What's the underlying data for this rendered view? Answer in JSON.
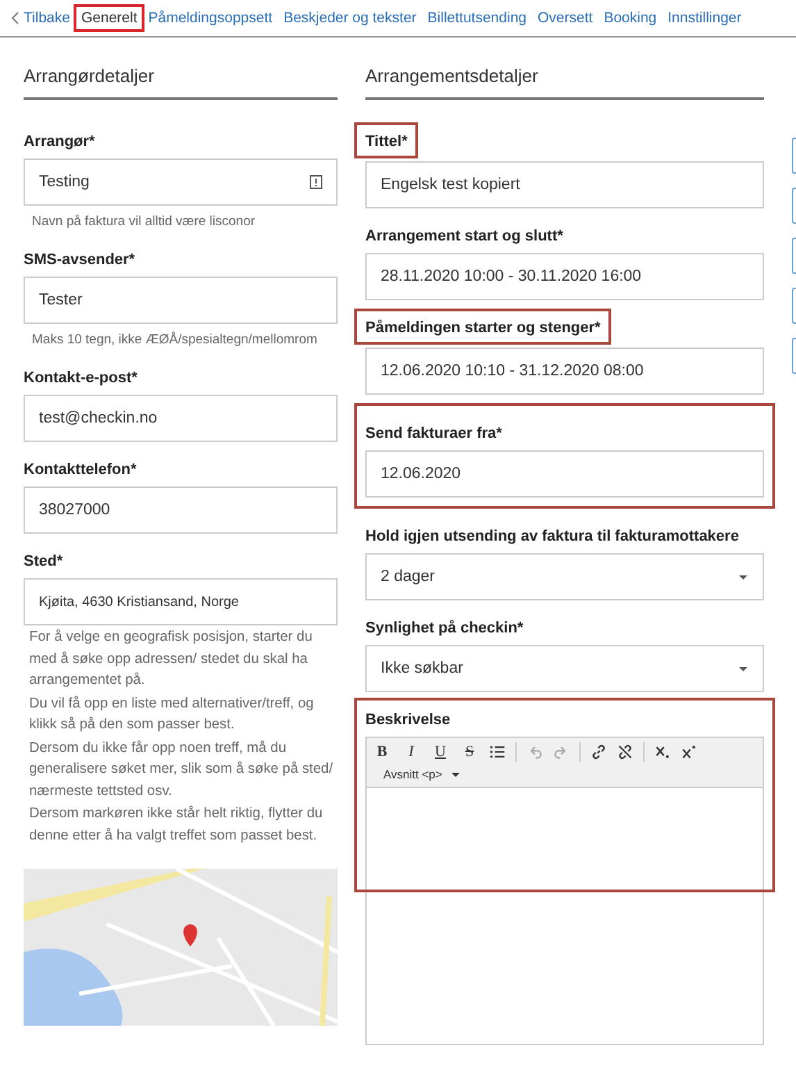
{
  "nav": {
    "back": "Tilbake",
    "tabs": [
      {
        "label": "Generelt",
        "selected": true,
        "highlighted": true
      },
      {
        "label": "Påmeldingsoppsett",
        "selected": false,
        "highlighted": false
      },
      {
        "label": "Beskjeder og tekster",
        "selected": false,
        "highlighted": false
      },
      {
        "label": "Billettutsending",
        "selected": false,
        "highlighted": false
      },
      {
        "label": "Oversett",
        "selected": false,
        "highlighted": false
      },
      {
        "label": "Booking",
        "selected": false,
        "highlighted": false
      },
      {
        "label": "Innstillinger",
        "selected": false,
        "highlighted": false
      }
    ]
  },
  "organizer": {
    "title": "Arrangørdetaljer",
    "fields": [
      {
        "kind": "text",
        "label": "Arrangør*",
        "value": "Testing",
        "info_icon": true,
        "hint": "Navn på faktura vil alltid være lisconor"
      },
      {
        "kind": "text",
        "label": "SMS-avsender*",
        "value": "Tester",
        "hint": "Maks 10 tegn, ikke ÆØÅ/spesialtegn/mellomrom"
      },
      {
        "kind": "text",
        "label": "Kontakt-e-post*",
        "value": "test@checkin.no"
      },
      {
        "kind": "text",
        "label": "Kontakttelefon*",
        "value": "38027000"
      },
      {
        "kind": "place",
        "label": "Sted*",
        "value": "Kjøita, 4630 Kristiansand, Norge",
        "help": [
          "For å velge en geografisk posisjon, starter du med å søke opp adressen/ stedet du skal ha arrangementet på.",
          "Du vil få opp en liste med alternativer/treff, og klikk så på den som passer best.",
          "Dersom du ikke får opp noen treff, må du generalisere søket mer, slik som å søke på sted/ nærmeste tettsted osv.",
          "Dersom markøren ikke står helt riktig, flytter du denne etter å ha valgt treffet som passet best."
        ]
      }
    ]
  },
  "event": {
    "title": "Arrangementsdetaljer",
    "fields": [
      {
        "kind": "text",
        "label": "Tittel*",
        "value": "Engelsk test kopiert",
        "label_highlighted": true
      },
      {
        "kind": "text",
        "label": "Arrangement start og slutt*",
        "value": "28.11.2020 10:00 - 30.11.2020 16:00"
      },
      {
        "kind": "text",
        "label": "Påmeldingen starter og stenger*",
        "value": "12.06.2020 10:10 - 31.12.2020 08:00",
        "label_highlighted": true
      },
      {
        "kind": "text",
        "label": "Send fakturaer fra*",
        "value": "12.06.2020",
        "group_highlighted": true
      },
      {
        "kind": "select",
        "label": "Hold igjen utsending av faktura til fakturamottakere",
        "value": "2 dager"
      },
      {
        "kind": "select",
        "label": "Synlighet på checkin*",
        "value": "Ikke søkbar"
      },
      {
        "kind": "editor",
        "label": "Beskrivelse",
        "group_highlighted": true,
        "toolbar": [
          {
            "kind": "bold",
            "label": "B"
          },
          {
            "kind": "italic",
            "label": "I"
          },
          {
            "kind": "underline",
            "label": "U"
          },
          {
            "kind": "strike",
            "label": "S"
          },
          {
            "kind": "list"
          },
          {
            "kind": "sep"
          },
          {
            "kind": "undo"
          },
          {
            "kind": "redo"
          },
          {
            "kind": "sep"
          },
          {
            "kind": "link"
          },
          {
            "kind": "unlink"
          },
          {
            "kind": "sep"
          },
          {
            "kind": "subscript"
          },
          {
            "kind": "superscript"
          }
        ],
        "format": "Avsnitt <p>"
      }
    ]
  }
}
